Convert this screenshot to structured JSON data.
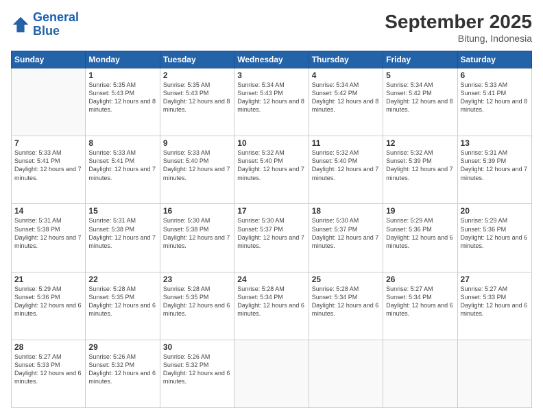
{
  "header": {
    "logo_line1": "General",
    "logo_line2": "Blue",
    "month": "September 2025",
    "location": "Bitung, Indonesia"
  },
  "days_of_week": [
    "Sunday",
    "Monday",
    "Tuesday",
    "Wednesday",
    "Thursday",
    "Friday",
    "Saturday"
  ],
  "weeks": [
    [
      {
        "day": "",
        "sunrise": "",
        "sunset": "",
        "daylight": ""
      },
      {
        "day": "1",
        "sunrise": "5:35 AM",
        "sunset": "5:43 PM",
        "daylight": "12 hours and 8 minutes."
      },
      {
        "day": "2",
        "sunrise": "5:35 AM",
        "sunset": "5:43 PM",
        "daylight": "12 hours and 8 minutes."
      },
      {
        "day": "3",
        "sunrise": "5:34 AM",
        "sunset": "5:43 PM",
        "daylight": "12 hours and 8 minutes."
      },
      {
        "day": "4",
        "sunrise": "5:34 AM",
        "sunset": "5:42 PM",
        "daylight": "12 hours and 8 minutes."
      },
      {
        "day": "5",
        "sunrise": "5:34 AM",
        "sunset": "5:42 PM",
        "daylight": "12 hours and 8 minutes."
      },
      {
        "day": "6",
        "sunrise": "5:33 AM",
        "sunset": "5:41 PM",
        "daylight": "12 hours and 8 minutes."
      }
    ],
    [
      {
        "day": "7",
        "sunrise": "5:33 AM",
        "sunset": "5:41 PM",
        "daylight": "12 hours and 7 minutes."
      },
      {
        "day": "8",
        "sunrise": "5:33 AM",
        "sunset": "5:41 PM",
        "daylight": "12 hours and 7 minutes."
      },
      {
        "day": "9",
        "sunrise": "5:33 AM",
        "sunset": "5:40 PM",
        "daylight": "12 hours and 7 minutes."
      },
      {
        "day": "10",
        "sunrise": "5:32 AM",
        "sunset": "5:40 PM",
        "daylight": "12 hours and 7 minutes."
      },
      {
        "day": "11",
        "sunrise": "5:32 AM",
        "sunset": "5:40 PM",
        "daylight": "12 hours and 7 minutes."
      },
      {
        "day": "12",
        "sunrise": "5:32 AM",
        "sunset": "5:39 PM",
        "daylight": "12 hours and 7 minutes."
      },
      {
        "day": "13",
        "sunrise": "5:31 AM",
        "sunset": "5:39 PM",
        "daylight": "12 hours and 7 minutes."
      }
    ],
    [
      {
        "day": "14",
        "sunrise": "5:31 AM",
        "sunset": "5:38 PM",
        "daylight": "12 hours and 7 minutes."
      },
      {
        "day": "15",
        "sunrise": "5:31 AM",
        "sunset": "5:38 PM",
        "daylight": "12 hours and 7 minutes."
      },
      {
        "day": "16",
        "sunrise": "5:30 AM",
        "sunset": "5:38 PM",
        "daylight": "12 hours and 7 minutes."
      },
      {
        "day": "17",
        "sunrise": "5:30 AM",
        "sunset": "5:37 PM",
        "daylight": "12 hours and 7 minutes."
      },
      {
        "day": "18",
        "sunrise": "5:30 AM",
        "sunset": "5:37 PM",
        "daylight": "12 hours and 7 minutes."
      },
      {
        "day": "19",
        "sunrise": "5:29 AM",
        "sunset": "5:36 PM",
        "daylight": "12 hours and 6 minutes."
      },
      {
        "day": "20",
        "sunrise": "5:29 AM",
        "sunset": "5:36 PM",
        "daylight": "12 hours and 6 minutes."
      }
    ],
    [
      {
        "day": "21",
        "sunrise": "5:29 AM",
        "sunset": "5:36 PM",
        "daylight": "12 hours and 6 minutes."
      },
      {
        "day": "22",
        "sunrise": "5:28 AM",
        "sunset": "5:35 PM",
        "daylight": "12 hours and 6 minutes."
      },
      {
        "day": "23",
        "sunrise": "5:28 AM",
        "sunset": "5:35 PM",
        "daylight": "12 hours and 6 minutes."
      },
      {
        "day": "24",
        "sunrise": "5:28 AM",
        "sunset": "5:34 PM",
        "daylight": "12 hours and 6 minutes."
      },
      {
        "day": "25",
        "sunrise": "5:28 AM",
        "sunset": "5:34 PM",
        "daylight": "12 hours and 6 minutes."
      },
      {
        "day": "26",
        "sunrise": "5:27 AM",
        "sunset": "5:34 PM",
        "daylight": "12 hours and 6 minutes."
      },
      {
        "day": "27",
        "sunrise": "5:27 AM",
        "sunset": "5:33 PM",
        "daylight": "12 hours and 6 minutes."
      }
    ],
    [
      {
        "day": "28",
        "sunrise": "5:27 AM",
        "sunset": "5:33 PM",
        "daylight": "12 hours and 6 minutes."
      },
      {
        "day": "29",
        "sunrise": "5:26 AM",
        "sunset": "5:32 PM",
        "daylight": "12 hours and 6 minutes."
      },
      {
        "day": "30",
        "sunrise": "5:26 AM",
        "sunset": "5:32 PM",
        "daylight": "12 hours and 6 minutes."
      },
      {
        "day": "",
        "sunrise": "",
        "sunset": "",
        "daylight": ""
      },
      {
        "day": "",
        "sunrise": "",
        "sunset": "",
        "daylight": ""
      },
      {
        "day": "",
        "sunrise": "",
        "sunset": "",
        "daylight": ""
      },
      {
        "day": "",
        "sunrise": "",
        "sunset": "",
        "daylight": ""
      }
    ]
  ]
}
